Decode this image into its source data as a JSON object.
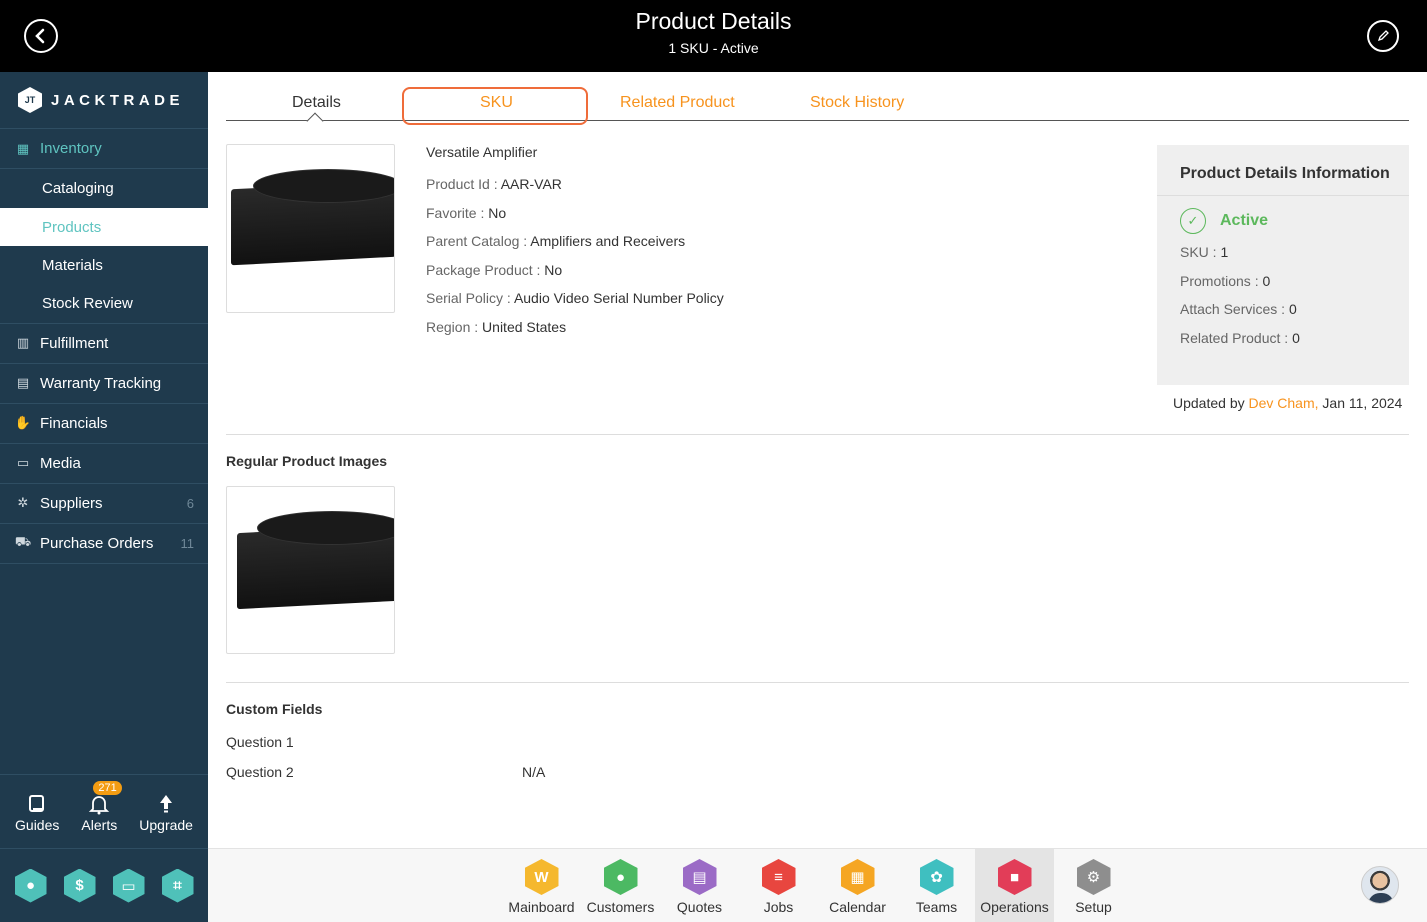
{
  "header": {
    "title": "Product Details",
    "subtitle": "1 SKU - Active"
  },
  "brand": {
    "name": "JACKTRADE",
    "mark": "JT"
  },
  "sidebar": {
    "inventory_label": "Inventory",
    "inventory_sub": [
      "Cataloging",
      "Products",
      "Materials",
      "Stock Review"
    ],
    "items": [
      {
        "label": "Fulfillment",
        "icon": "fulfillment-icon",
        "count": ""
      },
      {
        "label": "Warranty Tracking",
        "icon": "warranty-icon",
        "count": ""
      },
      {
        "label": "Financials",
        "icon": "financials-icon",
        "count": ""
      },
      {
        "label": "Media",
        "icon": "media-icon",
        "count": ""
      },
      {
        "label": "Suppliers",
        "icon": "suppliers-icon",
        "count": "6"
      },
      {
        "label": "Purchase Orders",
        "icon": "purchase-orders-icon",
        "count": "11"
      }
    ],
    "utilities": {
      "guides": "Guides",
      "alerts": "Alerts",
      "alerts_badge": "271",
      "upgrade": "Upgrade"
    }
  },
  "tabs": {
    "details": "Details",
    "sku": "SKU",
    "related": "Related Product",
    "stock": "Stock History"
  },
  "product": {
    "name": "Versatile Amplifier",
    "fields": [
      {
        "label": "Product Id : ",
        "value": "AAR-VAR"
      },
      {
        "label": "Favorite : ",
        "value": "No"
      },
      {
        "label": "Parent Catalog : ",
        "value": "Amplifiers and Receivers"
      },
      {
        "label": "Package Product : ",
        "value": "No"
      },
      {
        "label": "Serial Policy : ",
        "value": "Audio Video Serial Number Policy"
      },
      {
        "label": "Region : ",
        "value": "United States"
      }
    ]
  },
  "info_panel": {
    "title": "Product Details Information",
    "status": "Active",
    "rows": [
      {
        "label": "SKU : ",
        "value": "1"
      },
      {
        "label": "Promotions : ",
        "value": "0"
      },
      {
        "label": "Attach Services : ",
        "value": "0"
      },
      {
        "label": "Related Product : ",
        "value": "0"
      }
    ],
    "updated_prefix": "Updated by ",
    "updated_by": "Dev Cham,",
    "updated_date": " Jan 11, 2024"
  },
  "sections": {
    "images": "Regular Product Images",
    "custom": "Custom Fields"
  },
  "custom_fields": [
    {
      "label": "Question 1",
      "value": ""
    },
    {
      "label": "Question 2",
      "value": "N/A"
    }
  ],
  "appbar": {
    "apps": [
      {
        "label": "Mainboard",
        "color": "#f5b82e",
        "glyph": "W"
      },
      {
        "label": "Customers",
        "color": "#4cb963",
        "glyph": "●"
      },
      {
        "label": "Quotes",
        "color": "#9b6bc6",
        "glyph": "▤"
      },
      {
        "label": "Jobs",
        "color": "#e8463f",
        "glyph": "≡"
      },
      {
        "label": "Calendar",
        "color": "#f5a623",
        "glyph": "▦"
      },
      {
        "label": "Teams",
        "color": "#3fbfc0",
        "glyph": "✿"
      },
      {
        "label": "Operations",
        "color": "#e23d58",
        "glyph": "■"
      },
      {
        "label": "Setup",
        "color": "#8e8e8e",
        "glyph": "⚙"
      }
    ]
  }
}
